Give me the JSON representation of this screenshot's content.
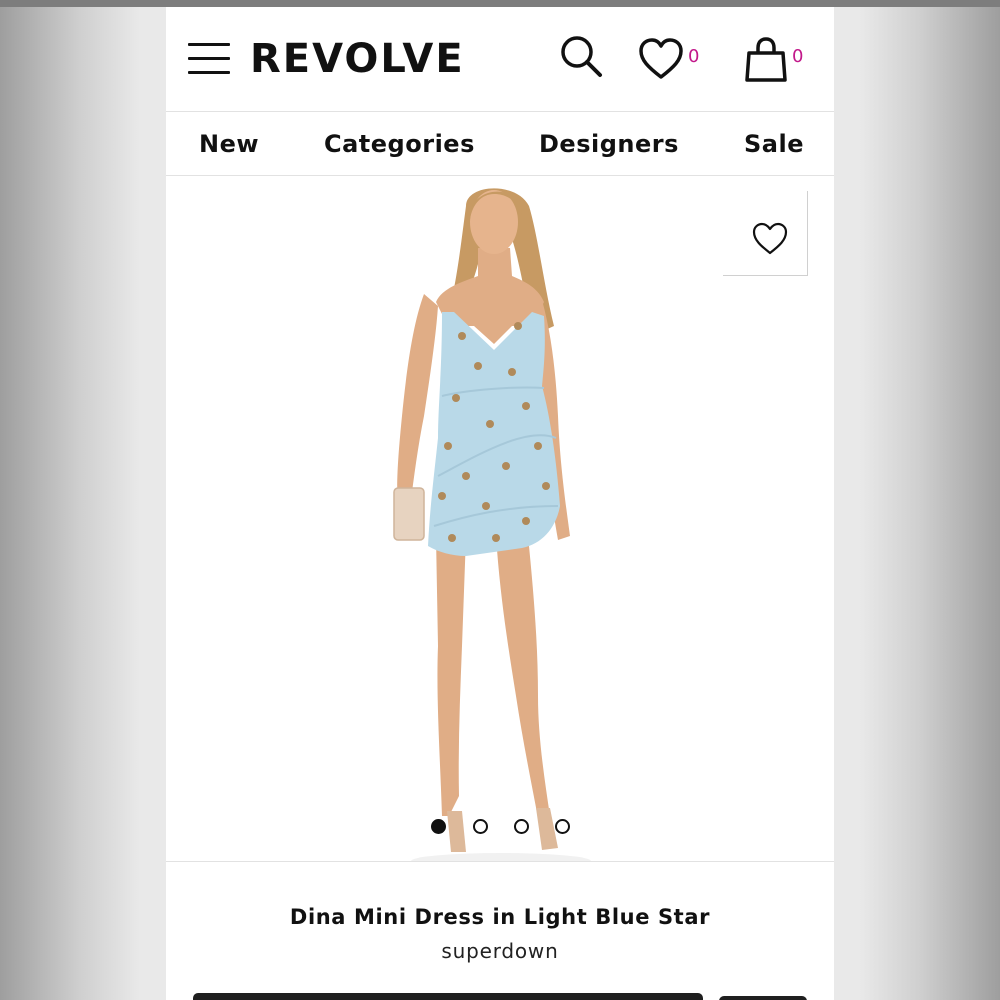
{
  "header": {
    "logo": "REVOLVE",
    "wishlist_count": "0",
    "bag_count": "0",
    "badge_color": "#c2188a"
  },
  "nav": {
    "items": [
      "New",
      "Categories",
      "Designers",
      "Sale"
    ]
  },
  "gallery": {
    "slide_count": 4,
    "active_slide": 1
  },
  "product": {
    "name": "Dina Mini Dress in Light Blue Star",
    "brand": "superdown"
  },
  "colors": {
    "dress": "#b9d9e8",
    "skin": "#e0ad86",
    "hair": "#c79a63",
    "star": "#b08a5a"
  }
}
